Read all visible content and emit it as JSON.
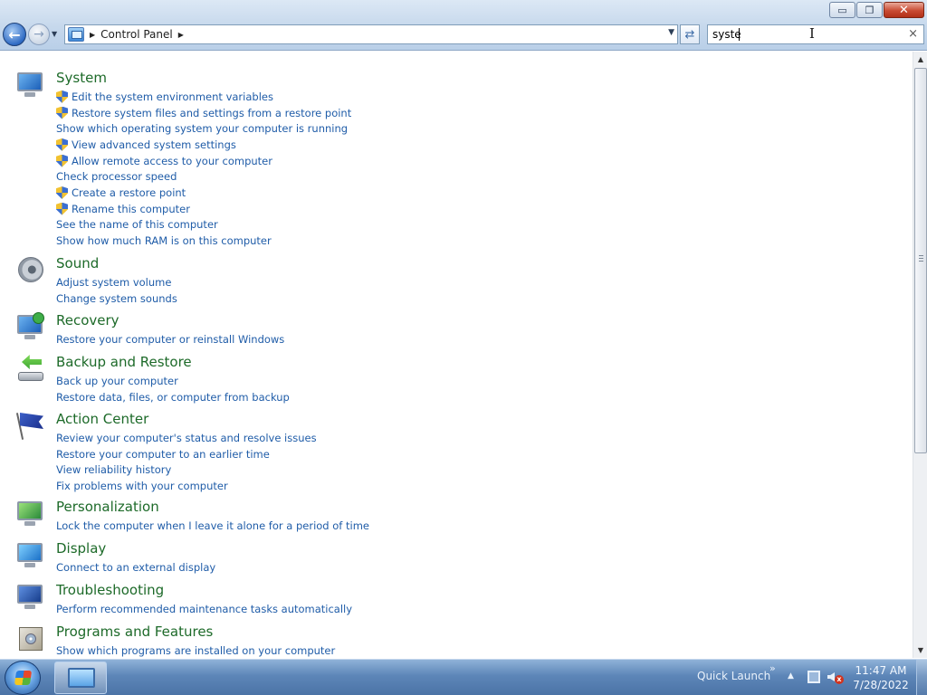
{
  "window": {
    "minimize_glyph": "▭",
    "restore_glyph": "❐",
    "close_glyph": "✕"
  },
  "navigation": {
    "back_glyph": "←",
    "forward_glyph": "→",
    "breadcrumb": "Control Panel",
    "search_value": "syste",
    "search_clear_glyph": "×"
  },
  "categories": [
    {
      "title": "System",
      "icon": "system-icon",
      "links": [
        {
          "label": "Edit the system environment variables",
          "shield": true
        },
        {
          "label": "Restore system files and settings from a restore point",
          "shield": true
        },
        {
          "label": "Show which operating system your computer is running",
          "shield": false
        },
        {
          "label": "View advanced system settings",
          "shield": true
        },
        {
          "label": "Allow remote access to your computer",
          "shield": true
        },
        {
          "label": "Check processor speed",
          "shield": false
        },
        {
          "label": "Create a restore point",
          "shield": true
        },
        {
          "label": "Rename this computer",
          "shield": true
        },
        {
          "label": "See the name of this computer",
          "shield": false
        },
        {
          "label": "Show how much RAM is on this computer",
          "shield": false
        }
      ]
    },
    {
      "title": "Sound",
      "icon": "speaker-icon",
      "links": [
        {
          "label": "Adjust system volume",
          "shield": false
        },
        {
          "label": "Change system sounds",
          "shield": false
        }
      ]
    },
    {
      "title": "Recovery",
      "icon": "recovery-icon",
      "links": [
        {
          "label": "Restore your computer or reinstall Windows",
          "shield": false
        }
      ]
    },
    {
      "title": "Backup and Restore",
      "icon": "backup-icon",
      "links": [
        {
          "label": "Back up your computer",
          "shield": false
        },
        {
          "label": "Restore data, files, or computer from backup",
          "shield": false
        }
      ]
    },
    {
      "title": "Action Center",
      "icon": "flag-icon",
      "links": [
        {
          "label": "Review your computer's status and resolve issues",
          "shield": false
        },
        {
          "label": "Restore your computer to an earlier time",
          "shield": false
        },
        {
          "label": "View reliability history",
          "shield": false
        },
        {
          "label": "Fix problems with your computer",
          "shield": false
        }
      ]
    },
    {
      "title": "Personalization",
      "icon": "personalization-icon",
      "links": [
        {
          "label": "Lock the computer when I leave it alone for a period of time",
          "shield": false
        }
      ]
    },
    {
      "title": "Display",
      "icon": "display-icon",
      "links": [
        {
          "label": "Connect to an external display",
          "shield": false
        }
      ]
    },
    {
      "title": "Troubleshooting",
      "icon": "troubleshooting-icon",
      "links": [
        {
          "label": "Perform recommended maintenance tasks automatically",
          "shield": false
        }
      ]
    },
    {
      "title": "Programs and Features",
      "icon": "programs-icon",
      "links": [
        {
          "label": "Show which programs are installed on your computer",
          "shield": false
        }
      ]
    }
  ],
  "taskbar": {
    "quick_launch": "Quick Launch",
    "quick_launch_chevron": "»",
    "tray_up": "▲",
    "time": "11:47 AM",
    "date": "7/28/2022"
  },
  "colors": {
    "category_title": "#1d6a29",
    "link": "#1f5ca8"
  }
}
